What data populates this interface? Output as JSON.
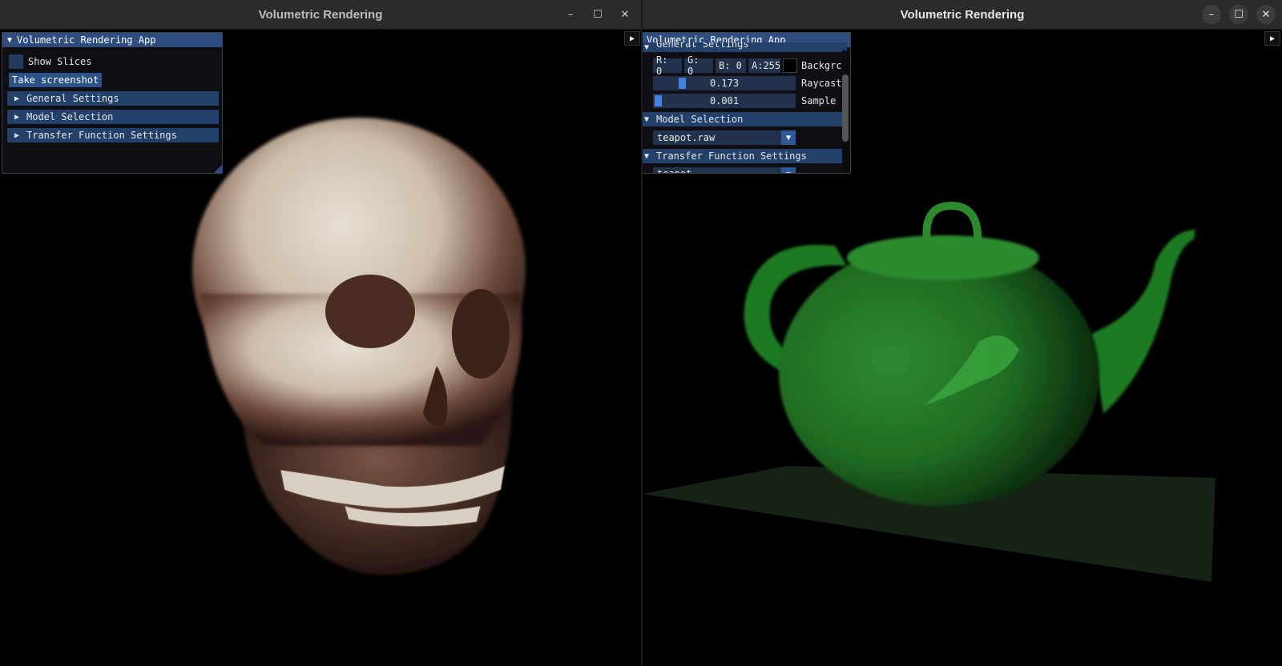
{
  "window_left": {
    "title": "Volumetric Rendering",
    "buttons": {
      "minimize": "–",
      "maximize": "☐",
      "close": "✕"
    },
    "panel": {
      "header": "Volumetric Rendering App",
      "show_slices_label": "Show Slices",
      "screenshot_button": "Take screenshot",
      "sections": [
        "General Settings",
        "Model Selection",
        "Transfer Function Settings"
      ]
    }
  },
  "window_right": {
    "title": "Volumetric Rendering",
    "buttons": {
      "minimize": "–",
      "maximize": "☐",
      "close": "✕"
    },
    "panel": {
      "header": "Volumetric Rendering App",
      "general_section": "General Settings",
      "rgba": {
        "r": "R:  0",
        "g": "G:  0",
        "b": "B:  0",
        "a": "A:255"
      },
      "background_label": "Backgrc",
      "raycast": {
        "value": "0.173",
        "label": "Raycast",
        "fraction": 0.173
      },
      "sample": {
        "value": "0.001",
        "label": "Sample",
        "fraction": 0.001
      },
      "model_section": "Model Selection",
      "model_value": "teapot.raw",
      "tf_section": "Transfer Function Settings",
      "tf_value": "teapot"
    }
  },
  "icons": {
    "expanded": "▼",
    "collapsed": "▶",
    "dropdown": "▼"
  }
}
